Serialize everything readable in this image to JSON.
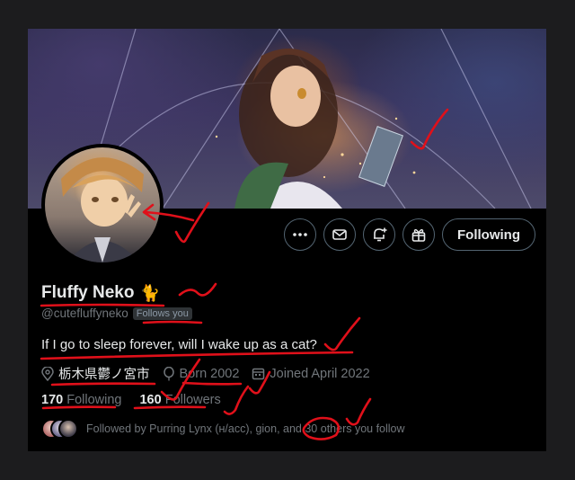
{
  "profile": {
    "display_name": "Fluffy Neko",
    "name_emoji": "🐈",
    "handle": "@cutefluffyneko",
    "follows_you_badge": "Follows you",
    "bio": "If I go to sleep forever, will I wake up as a cat?",
    "location": "栃木県鬱ノ宮市",
    "born": "Born 2002",
    "joined": "Joined April 2022"
  },
  "stats": {
    "following_count": "170",
    "following_label": "Following",
    "followers_count": "160",
    "followers_label": "Followers"
  },
  "followed_by": {
    "text": "Followed by Purring Lynx (ʜ/acc), gion, and 30 others you follow"
  },
  "actions": {
    "more_icon": "more-icon",
    "message_icon": "mail-icon",
    "notify_icon": "bell-plus-icon",
    "subscribe_icon": "gift-icon",
    "follow_label": "Following"
  },
  "colors": {
    "background": "#000000",
    "text": "#e7e9ea",
    "muted": "#71767b",
    "border": "#536471",
    "annotation": "#e0101a"
  }
}
